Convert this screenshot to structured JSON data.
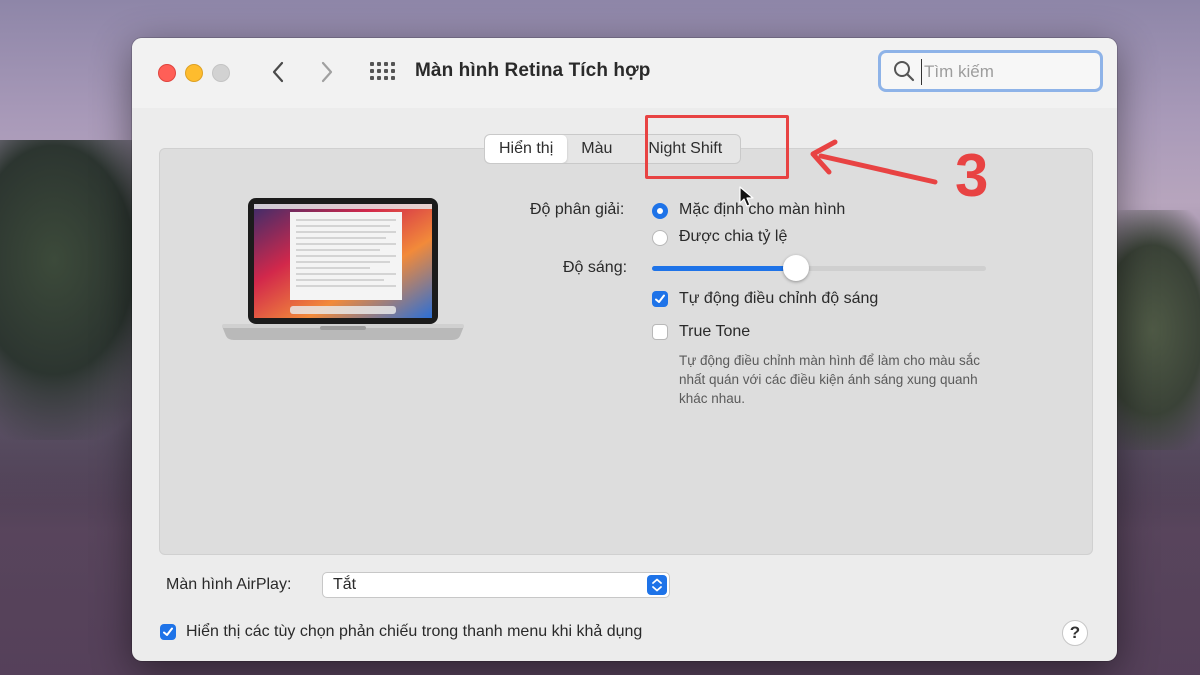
{
  "window": {
    "title": "Màn hình Retina Tích hợp",
    "search_placeholder": "Tìm kiếm"
  },
  "tabs": [
    {
      "label": "Hiển thị",
      "active": true
    },
    {
      "label": "Màu",
      "active": false
    },
    {
      "label": "Night Shift",
      "active": false
    }
  ],
  "display": {
    "resolution_label": "Độ phân giải:",
    "resolution_options": [
      {
        "label": "Mặc định cho màn hình",
        "selected": true
      },
      {
        "label": "Được chia tỷ lệ",
        "selected": false
      }
    ],
    "brightness_label": "Độ sáng:",
    "brightness_level": 0.43,
    "auto_brightness": {
      "label": "Tự động điều chỉnh độ sáng",
      "checked": true
    },
    "true_tone": {
      "label": "True Tone",
      "checked": false,
      "description": "Tự động điều chỉnh màn hình để làm cho màu sắc nhất quán với các điều kiện ánh sáng xung quanh khác nhau."
    }
  },
  "airplay": {
    "label": "Màn hình AirPlay:",
    "value": "Tắt"
  },
  "mirroring": {
    "label": "Hiển thị các tùy chọn phản chiếu trong thanh menu khi khả dụng",
    "checked": true
  },
  "help": {
    "label": "?"
  },
  "annotation": {
    "number": "3"
  },
  "colors": {
    "accent": "#1e73e8",
    "annotation": "#e84343"
  }
}
